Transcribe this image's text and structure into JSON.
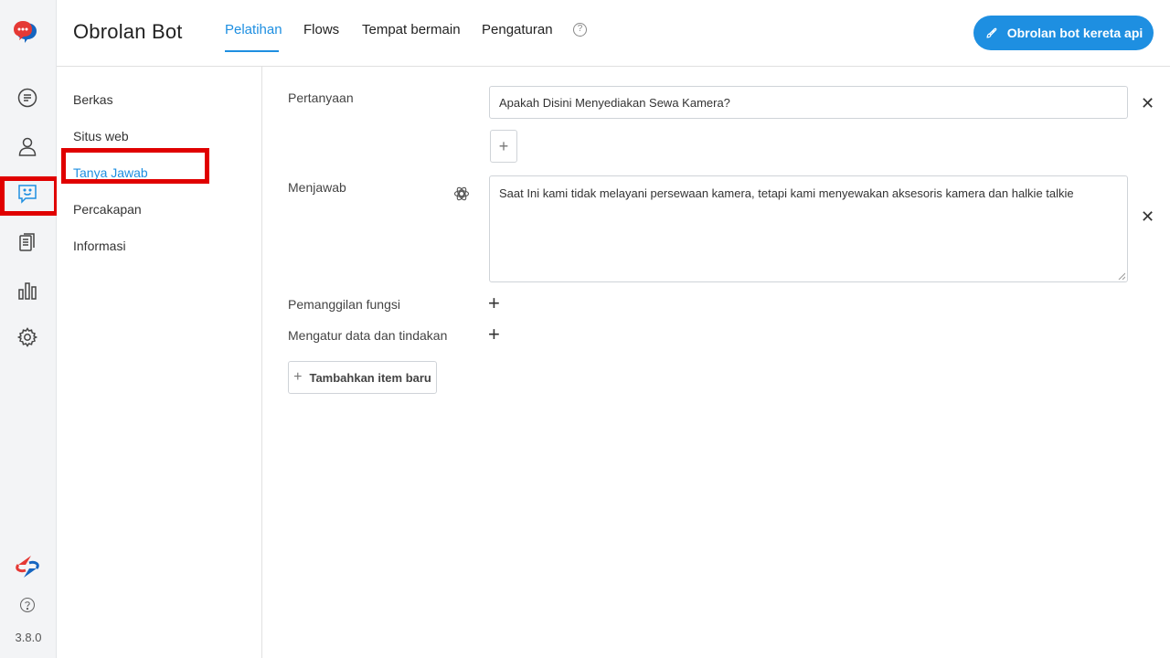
{
  "app": {
    "title": "Obrolan Bot",
    "version": "3.8.0"
  },
  "header": {
    "tabs": [
      {
        "label": "Pelatihan",
        "active": true
      },
      {
        "label": "Flows",
        "active": false
      },
      {
        "label": "Tempat bermain",
        "active": false
      },
      {
        "label": "Pengaturan",
        "active": false
      }
    ],
    "help_icon": "question-circle-icon",
    "train_button": "Obrolan bot kereta api"
  },
  "rail": {
    "icons": [
      "chat-bubbles-logo-icon",
      "message-icon",
      "user-icon",
      "bot-icon",
      "documents-icon",
      "bar-chart-icon",
      "gear-icon",
      "brand-logo-icon",
      "help-icon"
    ]
  },
  "subnav": {
    "items": [
      {
        "label": "Berkas",
        "active": false
      },
      {
        "label": "Situs web",
        "active": false
      },
      {
        "label": "Tanya Jawab",
        "active": true
      },
      {
        "label": "Percakapan",
        "active": false
      },
      {
        "label": "Informasi",
        "active": false
      }
    ]
  },
  "qa": {
    "question_label": "Pertanyaan",
    "question_value": "Apakah Disini Menyediakan Sewa Kamera?",
    "answer_label": "Menjawab",
    "answer_value": "Saat Ini kami tidak melayani persewaan kamera, tetapi kami menyewakan aksesoris kamera dan halkie talkie",
    "function_call_label": "Pemanggilan fungsi",
    "data_action_label": "Mengatur data dan tindakan",
    "add_item_label": "Tambahkan item baru",
    "plus_symbol": "+",
    "close_symbol": "✕"
  },
  "colors": {
    "accent": "#1e8fe1",
    "highlight": "#e00000",
    "logo_red": "#e53935",
    "logo_blue": "#1565c0"
  }
}
